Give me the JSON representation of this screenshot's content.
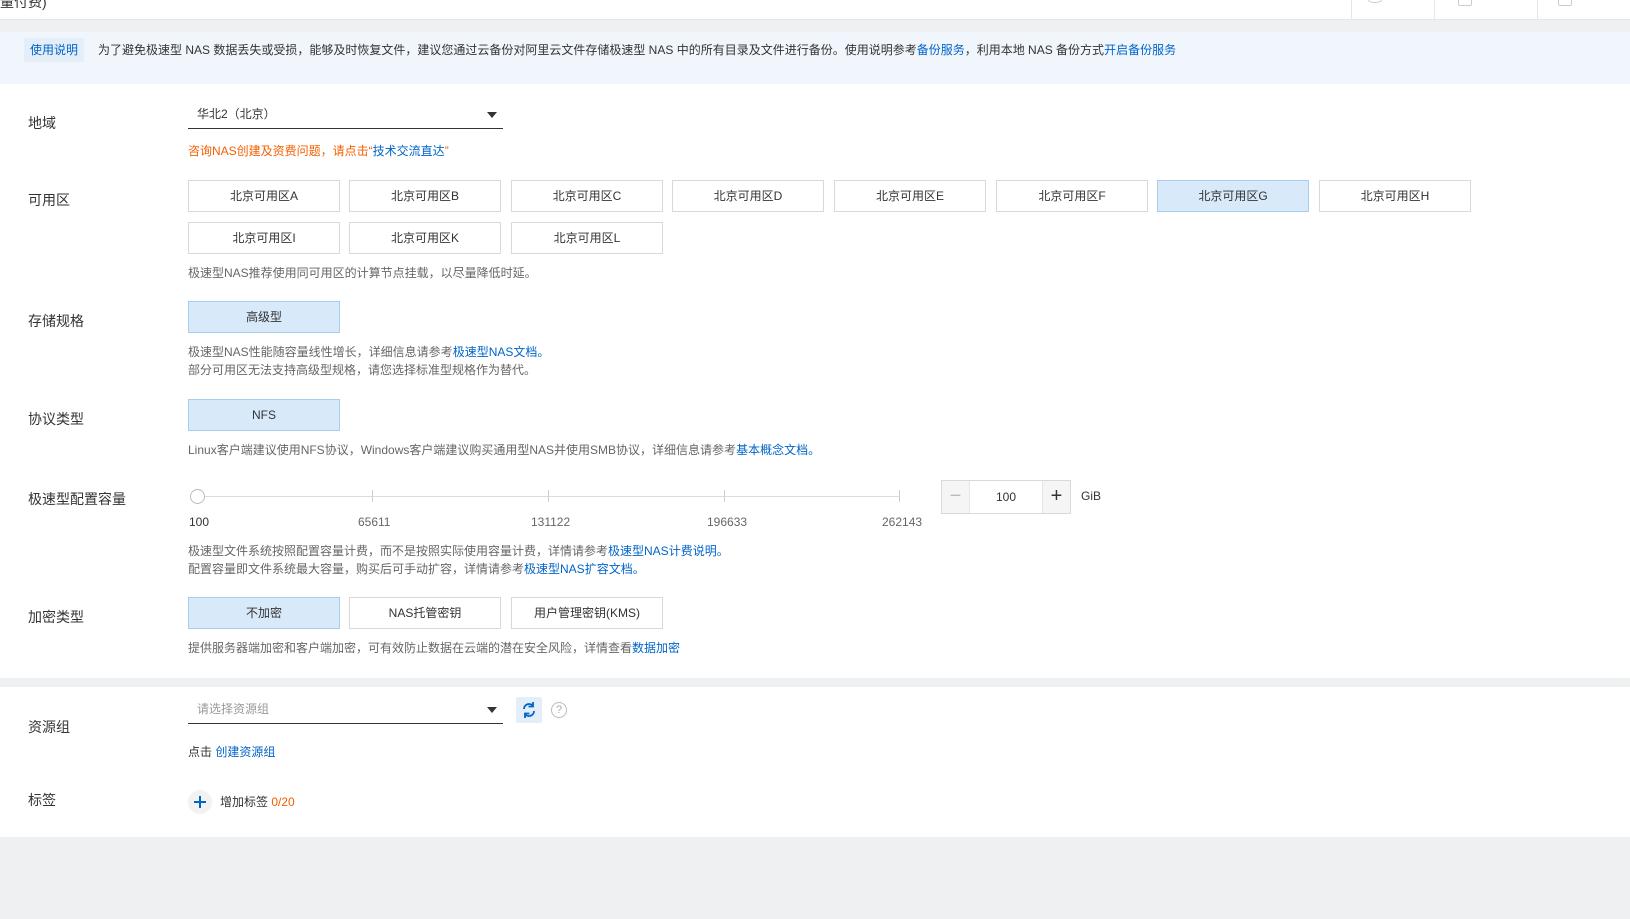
{
  "header": {
    "title": "量付费)"
  },
  "notice": {
    "tag": "使用说明",
    "text_before": "为了避免极速型 NAS 数据丢失或受损，能够及时恢复文件，建议您通过云备份对阿里云文件存储极速型 NAS 中的所有目录及文件进行备份。使用说明参考",
    "link1": "备份服务",
    "text_mid": "，利用本地 NAS 备份方式",
    "link2": "开启备份服务"
  },
  "region": {
    "label": "地域",
    "value": "华北2（北京）",
    "consult_prefix": "咨询NAS创建及资费问题，请点击“",
    "consult_link": "技术交流直达",
    "consult_suffix": "”"
  },
  "zone": {
    "label": "可用区",
    "options": [
      "北京可用区A",
      "北京可用区B",
      "北京可用区C",
      "北京可用区D",
      "北京可用区E",
      "北京可用区F",
      "北京可用区G",
      "北京可用区H",
      "北京可用区I",
      "北京可用区K",
      "北京可用区L"
    ],
    "selected": "北京可用区G",
    "hint": "极速型NAS推荐使用同可用区的计算节点挂载，以尽量降低时延。"
  },
  "storage_spec": {
    "label": "存储规格",
    "option": "高级型",
    "hint1_prefix": "极速型NAS性能随容量线性增长，详细信息请参考",
    "hint1_link": "极速型NAS文档。",
    "hint2": "部分可用区无法支持高级型规格，请您选择标准型规格作为替代。"
  },
  "protocol": {
    "label": "协议类型",
    "option": "NFS",
    "hint_prefix": "Linux客户端建议使用NFS协议，Windows客户端建议购买通用型NAS并使用SMB协议，详细信息请参考",
    "hint_link": "基本概念文档。"
  },
  "capacity": {
    "label": "极速型配置容量",
    "ticks": [
      "100",
      "65611",
      "131122",
      "196633",
      "262143"
    ],
    "value": "100",
    "value_fraction": 0,
    "unit": "GiB",
    "hint1_prefix": "极速型文件系统按照配置容量计费，而不是按照实际使用容量计费，详情请参考",
    "hint1_link": "极速型NAS计费说明。",
    "hint2_prefix": "配置容量即文件系统最大容量，购买后可手动扩容，详情请参考",
    "hint2_link": "极速型NAS扩容文档。"
  },
  "encryption": {
    "label": "加密类型",
    "options": [
      "不加密",
      "NAS托管密钥",
      "用户管理密钥(KMS)"
    ],
    "selected": "不加密",
    "hint_prefix": "提供服务器端加密和客户端加密，可有效防止数据在云端的潜在安全风险，详情查看",
    "hint_link": "数据加密"
  },
  "resource_group": {
    "label": "资源组",
    "placeholder": "请选择资源组",
    "hint_prefix": "点击",
    "hint_link": "创建资源组"
  },
  "tags": {
    "label": "标签",
    "add_label": "增加标签",
    "count": "0/20"
  },
  "colors": {
    "link": "#0064c8",
    "selected_bg": "#d8e9fa",
    "warning": "#f45f00"
  }
}
